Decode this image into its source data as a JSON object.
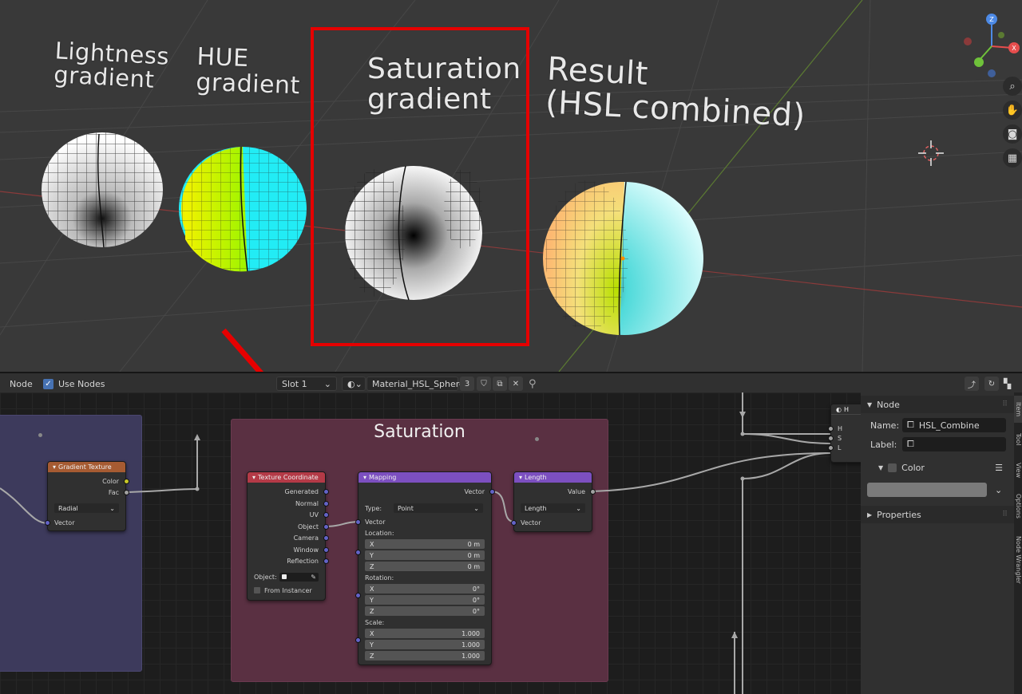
{
  "viewport": {
    "labels": {
      "lightness": [
        "Lightness",
        "gradient"
      ],
      "hue": [
        "HUE",
        "gradient"
      ],
      "saturation": [
        "Saturation",
        "gradient"
      ],
      "result": [
        "Result",
        "(HSL combined)"
      ]
    },
    "gizmo": {
      "z": "Z",
      "y": "Y",
      "x": "X"
    },
    "highlight_color": "#e50000"
  },
  "header": {
    "menu_node": "Node",
    "use_nodes_label": "Use Nodes",
    "use_nodes_checked": true,
    "slot": "Slot 1",
    "material_name": "Material_HSL_Sphere",
    "user_count": "3"
  },
  "canvas": {
    "frame_title": "Saturation",
    "gradient_texture": {
      "title": "Gradient Texture",
      "out_color": "Color",
      "out_fac": "Fac",
      "type": "Radial",
      "in_vector": "Vector"
    },
    "texture_coordinate": {
      "title": "Texture Coordinate",
      "outputs": [
        "Generated",
        "Normal",
        "UV",
        "Object",
        "Camera",
        "Window",
        "Reflection"
      ],
      "object_label": "Object:",
      "from_instancer": "From Instancer"
    },
    "mapping": {
      "title": "Mapping",
      "out_vector": "Vector",
      "type_label": "Type:",
      "type_value": "Point",
      "in_vector": "Vector",
      "location_label": "Location:",
      "location": [
        [
          "X",
          "0 m"
        ],
        [
          "Y",
          "0 m"
        ],
        [
          "Z",
          "0 m"
        ]
      ],
      "rotation_label": "Rotation:",
      "rotation": [
        [
          "X",
          "0°"
        ],
        [
          "Y",
          "0°"
        ],
        [
          "Z",
          "0°"
        ]
      ],
      "scale_label": "Scale:",
      "scale": [
        [
          "X",
          "1.000"
        ],
        [
          "Y",
          "1.000"
        ],
        [
          "Z",
          "1.000"
        ]
      ]
    },
    "length": {
      "title": "Length",
      "out_value": "Value",
      "operation": "Length",
      "in_vector": "Vector"
    },
    "combine": {
      "title": "H",
      "inputs": [
        "H",
        "S",
        "L"
      ]
    }
  },
  "sidebar": {
    "panel_node": "Node",
    "name_label": "Name:",
    "name_value": "HSL_Combine",
    "label_label": "Label:",
    "label_value": "",
    "color_section": "Color",
    "properties_section": "Properties",
    "tabs": [
      "Item",
      "Tool",
      "View",
      "Options",
      "Node Wrangler"
    ]
  }
}
